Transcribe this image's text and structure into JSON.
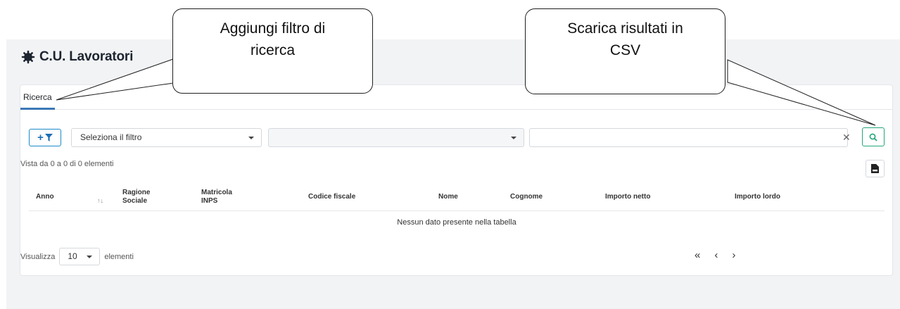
{
  "header": {
    "title": "C.U. Lavoratori",
    "title_icon": "gear-icon"
  },
  "tabs": [
    {
      "label": "Ricerca",
      "active": true
    }
  ],
  "filters": {
    "add_filter_icon": "plus-filter-icon",
    "field_select": {
      "value": "Seleziona il filtro"
    },
    "operator_select": {
      "value": ""
    },
    "value_input": {
      "value": ""
    },
    "clear_icon": "close-icon",
    "search_icon": "search-icon"
  },
  "table": {
    "info": "Vista da 0 a 0 di 0 elementi",
    "export_icon": "csv-file-icon",
    "columns": [
      "Anno",
      "Ragione Sociale",
      "Matricola INPS",
      "Codice fiscale",
      "Nome",
      "Cognome",
      "Importo netto",
      "Importo lordo"
    ],
    "sort_icon": "↑↓",
    "empty_message": "Nessun dato presente nella tabella"
  },
  "length_menu": {
    "prefix": "Visualizza",
    "value": "10",
    "suffix": "elementi"
  },
  "pagination": {
    "first": "«",
    "prev": "‹",
    "next": "›"
  },
  "callouts": [
    {
      "text_line1": "Aggiungi filtro di",
      "text_line2": "ricerca"
    },
    {
      "text_line1": "Scarica risultati in",
      "text_line2": "CSV"
    }
  ],
  "colors": {
    "accent_blue": "#1c6fb5",
    "accent_green": "#23a57a",
    "tab_underline": "#3b77b7",
    "app_bg": "#f2f3f5"
  }
}
